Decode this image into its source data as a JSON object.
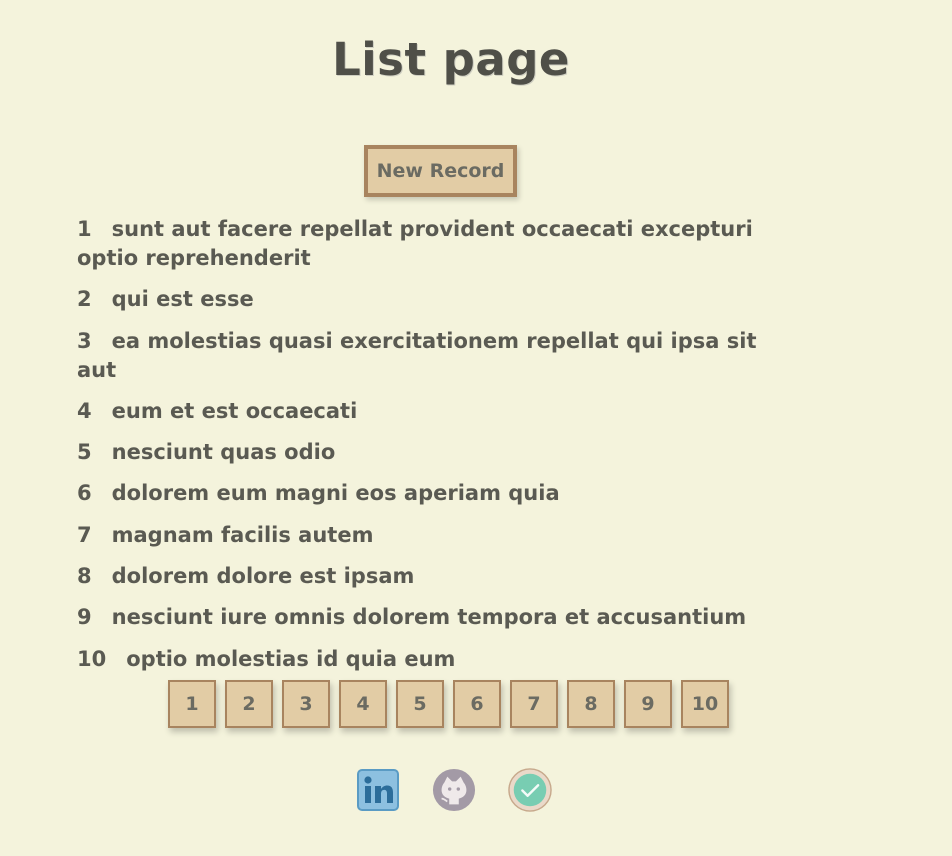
{
  "page": {
    "title": "List page"
  },
  "toolbar": {
    "new_record_label": "New Record"
  },
  "records": [
    {
      "id": "1",
      "title": "sunt aut facere repellat provident occaecati excepturi optio reprehenderit"
    },
    {
      "id": "2",
      "title": "qui est esse"
    },
    {
      "id": "3",
      "title": "ea molestias quasi exercitationem repellat qui ipsa sit aut"
    },
    {
      "id": "4",
      "title": "eum et est occaecati"
    },
    {
      "id": "5",
      "title": "nesciunt quas odio"
    },
    {
      "id": "6",
      "title": "dolorem eum magni eos aperiam quia"
    },
    {
      "id": "7",
      "title": "magnam facilis autem"
    },
    {
      "id": "8",
      "title": "dolorem dolore est ipsam"
    },
    {
      "id": "9",
      "title": "nesciunt iure omnis dolorem tempora et accusantium"
    },
    {
      "id": "10",
      "title": "optio molestias id quia eum"
    }
  ],
  "pagination": {
    "pages": [
      "1",
      "2",
      "3",
      "4",
      "5",
      "6",
      "7",
      "8",
      "9",
      "10"
    ]
  },
  "social": [
    {
      "name": "linkedin-icon"
    },
    {
      "name": "github-icon"
    },
    {
      "name": "checkmark-badge-icon"
    }
  ],
  "colors": {
    "background": "#f4f3dc",
    "button_fill": "#e2cca5",
    "button_border": "#a8845f",
    "text": "#5a5a52"
  }
}
